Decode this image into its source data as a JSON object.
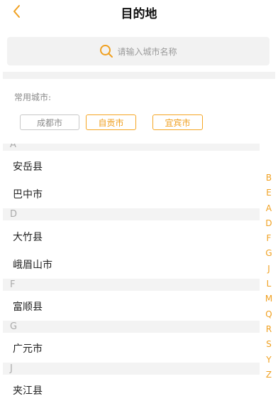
{
  "header": {
    "title": "目的地",
    "back_icon": "chevron-left-icon"
  },
  "search": {
    "placeholder": "请输入城市名称",
    "icon": "search-icon"
  },
  "common": {
    "label": "常用城市:",
    "cities": [
      "成都市",
      "自贡市",
      "宜宾市"
    ]
  },
  "list": {
    "section_a": "A",
    "a_cities": [
      "安岳县",
      "巴中市"
    ],
    "section_d": "D",
    "d_cities": [
      "大竹县",
      "峨眉山市"
    ],
    "section_f": "F",
    "f_cities": [
      "富顺县"
    ],
    "section_g": "G",
    "g_cities": [
      "广元市"
    ],
    "section_j": "J",
    "j_cities": [
      "夹江县"
    ]
  },
  "index_letters": [
    "B",
    "E",
    "A",
    "D",
    "F",
    "G",
    "J",
    "L",
    "M",
    "Q",
    "R",
    "S",
    "Y",
    "Z"
  ],
  "colors": {
    "accent": "#f0a020",
    "grey_text": "#8a8a8a",
    "section_bg": "#f3f3f3"
  }
}
